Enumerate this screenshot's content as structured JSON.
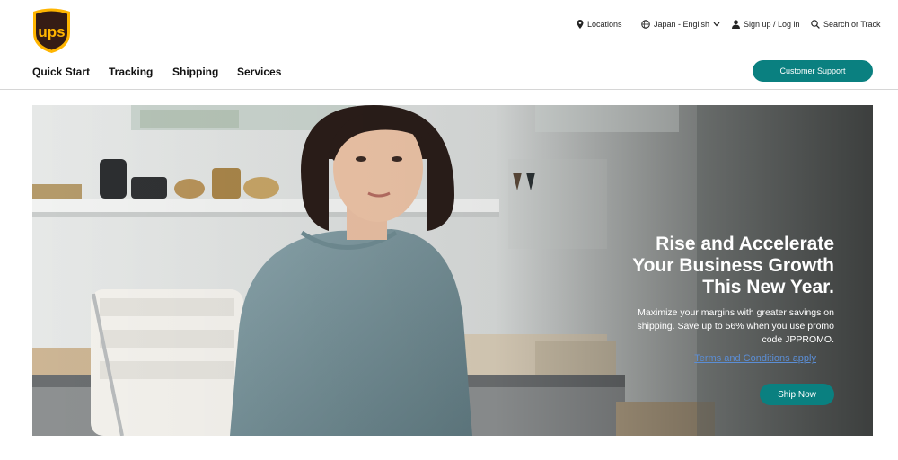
{
  "brand": {
    "logo_text": "ups",
    "colors": {
      "brown": "#351c15",
      "gold": "#ffb500",
      "teal": "#0a8080"
    }
  },
  "utility": {
    "locations": "Locations",
    "language": "Japan - English",
    "signin": "Sign up / Log in",
    "search": "Search or Track"
  },
  "nav": {
    "quick_start": "Quick Start",
    "tracking": "Tracking",
    "shipping": "Shipping",
    "services": "Services",
    "customer_support": "Customer Support"
  },
  "hero": {
    "title_line1": "Rise and Accelerate",
    "title_line2": "Your Business Growth",
    "title_line3": "This New Year.",
    "body_line1": "Maximize your margins with greater savings on",
    "body_line2": "shipping. Save up to 56% when you use promo",
    "body_line3": "code JPPROMO.",
    "terms": "Terms and Conditions apply",
    "cta": "Ship Now"
  }
}
